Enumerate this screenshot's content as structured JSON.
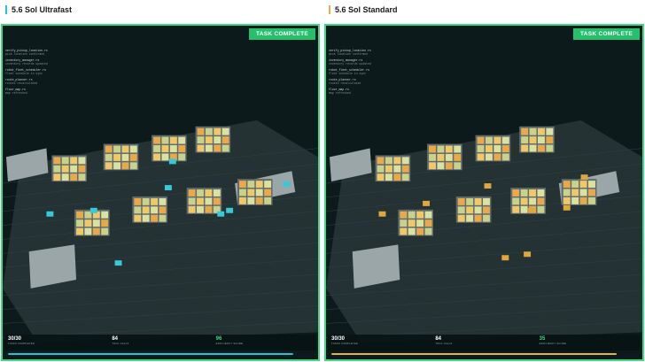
{
  "panels": [
    {
      "title": "5.6 Sol Ultrafast",
      "accent": "#22c3d6",
      "badge": "TASK COMPLETE",
      "log": [
        {
          "title": "verify_pickup_location.rs",
          "sub": "pick location confirmed"
        },
        {
          "title": "inventory_manager.rs",
          "sub": "inventory records updated"
        },
        {
          "title": "robot_fleet_scheduler.rs",
          "sub": "fleet schedule in sync"
        },
        {
          "title": "route_planner.rs",
          "sub": "routes recalculated"
        },
        {
          "title": "floor_map.rs",
          "sub": "map refreshed"
        }
      ],
      "stats": [
        {
          "value": "30/30",
          "label": "TASKS COMPLETED"
        },
        {
          "value": "84",
          "label": "TOOL CALLS"
        },
        {
          "value": "96",
          "label": "EFFICIENCY SCORE"
        }
      ],
      "progress": 1.0
    },
    {
      "title": "5.6 Sol Standard",
      "accent": "#e8b04a",
      "badge": "TASK COMPLETE",
      "log": [
        {
          "title": "verify_pickup_location.rs",
          "sub": "pick location confirmed"
        },
        {
          "title": "inventory_manager.rs",
          "sub": "inventory records updated"
        },
        {
          "title": "robot_fleet_scheduler.rs",
          "sub": "fleet schedule in sync"
        },
        {
          "title": "route_planner.rs",
          "sub": "routes recalculated"
        },
        {
          "title": "floor_map.rs",
          "sub": "map refreshed"
        }
      ],
      "stats": [
        {
          "value": "30/30",
          "label": "TASKS COMPLETED"
        },
        {
          "value": "84",
          "label": "TOOL CALLS"
        },
        {
          "value": "35",
          "label": "EFFICIENCY SCORE"
        }
      ],
      "progress": 1.0
    }
  ]
}
